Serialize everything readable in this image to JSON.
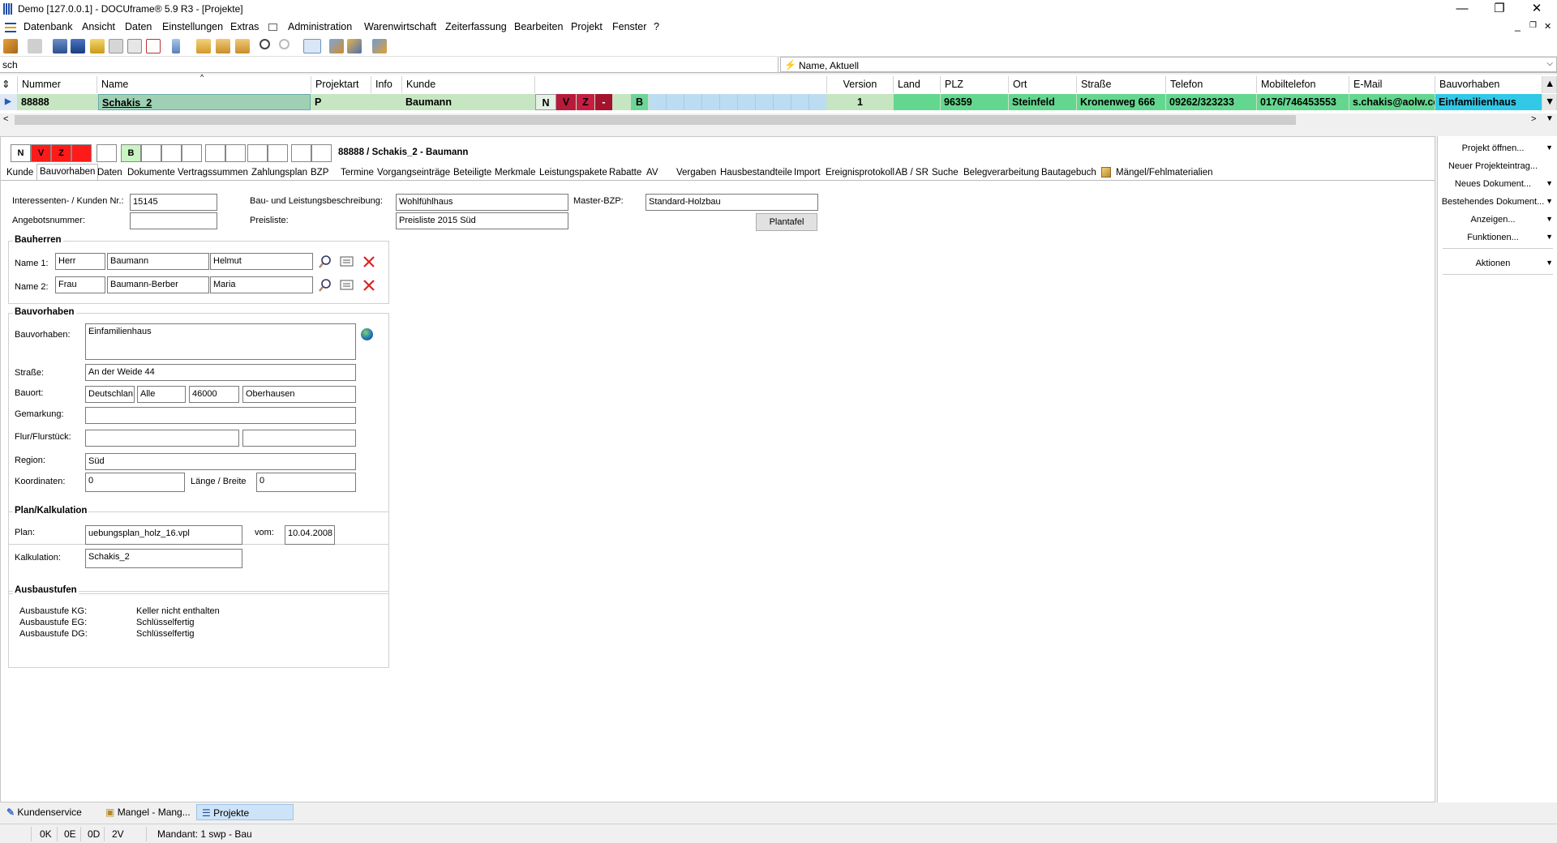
{
  "window": {
    "title": "Demo [127.0.0.1] - DOCUframe® 5.9 R3 - [Projekte]",
    "min": "—",
    "restore": "❐",
    "close": "✕",
    "mdi_min": "_",
    "mdi_restore": "❐",
    "mdi_close": "✕"
  },
  "menu": [
    "Datenbank",
    "Ansicht",
    "Daten",
    "Einstellungen",
    "Extras",
    "Administration",
    "Warenwirtschaft",
    "Zeiterfassung",
    "Bearbeiten",
    "Projekt",
    "Fenster",
    "?"
  ],
  "search": {
    "value": "sch",
    "sort_label": "Name, Aktuell"
  },
  "grid": {
    "headers": [
      "Nummer",
      "Name",
      "Projektart",
      "Info",
      "Kunde",
      "Version",
      "Land",
      "PLZ",
      "Ort",
      "Straße",
      "Telefon",
      "Mobiltelefon",
      "E-Mail",
      "Bauvorhaben"
    ],
    "row": {
      "nummer": "88888",
      "name": "Schakis_2",
      "projektart": "P",
      "info": "",
      "kunde": "Baumann",
      "flags": [
        "N",
        "V",
        "Z",
        "-",
        "",
        "B"
      ],
      "version": "1",
      "land": "",
      "plz": "96359",
      "ort": "Steinfeld",
      "strasse": "Kronenweg 666",
      "telefon": "09262/323233",
      "mobil": "0176/746453553",
      "email": "s.chakis@aolw.cor",
      "bauvorhaben": "Einfamilienhaus"
    }
  },
  "detail": {
    "flags": [
      "N",
      "V",
      "Z",
      "",
      "",
      "B"
    ],
    "heading": "88888 / Schakis_2 - Baumann",
    "tabs": [
      "Kunde",
      "Bauvorhaben",
      "Daten",
      "Dokumente",
      "Vertragssummen",
      "Zahlungsplan",
      "BZP",
      "Termine",
      "Vorgangseinträge",
      "Beteiligte",
      "Merkmale",
      "Leistungspakete",
      "Rabatte",
      "AV",
      "Vergaben",
      "Hausbestandteile",
      "Import",
      "Ereignisprotokoll",
      "AB / SR",
      "Suche",
      "Belegverarbeitung",
      "Bautagebuch",
      "Mängel/Fehlmaterialien"
    ],
    "top": {
      "kunden_nr_label": "Interessenten- / Kunden Nr.:",
      "kunden_nr": "15145",
      "angebot_label": "Angebotsnummer:",
      "angebot": "",
      "bau_label": "Bau- und Leistungsbeschreibung:",
      "bau": "Wohlfühlhaus",
      "preis_label": "Preisliste:",
      "preis": "Preisliste 2015 Süd",
      "master_label": "Master-BZP:",
      "master": "Standard-Holzbau",
      "plantafel": "Plantafel"
    },
    "bauherren": {
      "title": "Bauherren",
      "n1_label": "Name 1:",
      "n1_anrede": "Herr",
      "n1_nachname": "Baumann",
      "n1_vorname": "Helmut",
      "n2_label": "Name 2:",
      "n2_anrede": "Frau",
      "n2_nachname": "Baumann-Berber",
      "n2_vorname": "Maria"
    },
    "bauvorhaben": {
      "title": "Bauvorhaben",
      "bv_label": "Bauvorhaben:",
      "bv": "Einfamilienhaus",
      "strasse_label": "Straße:",
      "strasse": "An der Weide 44",
      "bauort_label": "Bauort:",
      "land": "Deutschlan",
      "alle": "Alle",
      "plz": "46000",
      "ort": "Oberhausen",
      "gemarkung_label": "Gemarkung:",
      "gemarkung": "",
      "flur_label": "Flur/Flurstück:",
      "flur1": "",
      "flur2": "",
      "region_label": "Region:",
      "region": "Süd",
      "koord_label": "Koordinaten:",
      "koord": "0",
      "lb_label": "Länge / Breite",
      "lb": "0"
    },
    "plan": {
      "title": "Plan/Kalkulation",
      "plan_label": "Plan:",
      "plan": "uebungsplan_holz_16.vpl",
      "vom_label": "vom:",
      "vom": "10.04.2008",
      "kalk_label": "Kalkulation:",
      "kalk": "Schakis_2"
    },
    "ausbau": {
      "title": "Ausbaustufen",
      "rows": [
        {
          "label": "Ausbaustufe KG:",
          "value": "Keller nicht enthalten"
        },
        {
          "label": "Ausbaustufe EG:",
          "value": "Schlüsselfertig"
        },
        {
          "label": "Ausbaustufe DG:",
          "value": "Schlüsselfertig"
        }
      ]
    }
  },
  "side": [
    "Projekt öffnen...",
    "Neuer Projekteintrag...",
    "Neues Dokument...",
    "Bestehendes Dokument...",
    "Anzeigen...",
    "Funktionen...",
    "Aktionen"
  ],
  "bottom_tabs": [
    "Kundenservice",
    "Mangel - Mang...",
    "Projekte"
  ],
  "status": [
    "0K",
    "0E",
    "0D",
    "2V",
    "Mandant: 1 swp - Bau"
  ]
}
